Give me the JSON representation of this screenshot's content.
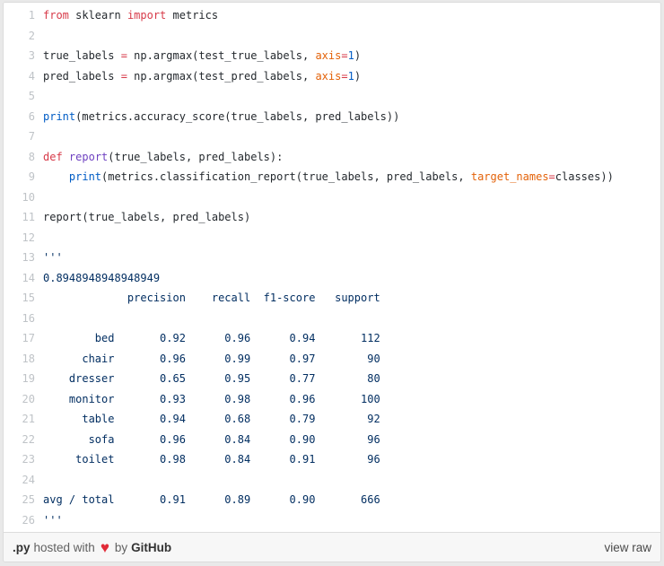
{
  "colors": {
    "keyword": "#d73a49",
    "builtin_number": "#005cc5",
    "function_name": "#6f42c1",
    "parameter": "#e36209",
    "string": "#032f62",
    "text": "#24292e",
    "line_number": "#bfc3c7",
    "border": "#dcdcdc",
    "footer_bg": "#f7f7f7",
    "footer_muted": "#616161",
    "footer_link": "#333333",
    "heart": "#e12b38"
  },
  "code": {
    "lines": [
      {
        "n": "1",
        "tokens": [
          [
            "k",
            "from"
          ],
          [
            "p",
            " sklearn "
          ],
          [
            "k",
            "import"
          ],
          [
            "p",
            " metrics"
          ]
        ]
      },
      {
        "n": "2",
        "tokens": []
      },
      {
        "n": "3",
        "tokens": [
          [
            "p",
            "true_labels "
          ],
          [
            "k",
            "="
          ],
          [
            "p",
            " np.argmax(test_true_labels, "
          ],
          [
            "o",
            "axis"
          ],
          [
            "k",
            "="
          ],
          [
            "b",
            "1"
          ],
          [
            "p",
            ")"
          ]
        ]
      },
      {
        "n": "4",
        "tokens": [
          [
            "p",
            "pred_labels "
          ],
          [
            "k",
            "="
          ],
          [
            "p",
            " np.argmax(test_pred_labels, "
          ],
          [
            "o",
            "axis"
          ],
          [
            "k",
            "="
          ],
          [
            "b",
            "1"
          ],
          [
            "p",
            ")"
          ]
        ]
      },
      {
        "n": "5",
        "tokens": []
      },
      {
        "n": "6",
        "tokens": [
          [
            "b",
            "print"
          ],
          [
            "p",
            "(metrics.accuracy_score(true_labels, pred_labels))"
          ]
        ]
      },
      {
        "n": "7",
        "tokens": []
      },
      {
        "n": "8",
        "tokens": [
          [
            "k",
            "def"
          ],
          [
            "p",
            " "
          ],
          [
            "f",
            "report"
          ],
          [
            "p",
            "(true_labels, pred_labels):"
          ]
        ]
      },
      {
        "n": "9",
        "tokens": [
          [
            "p",
            "    "
          ],
          [
            "b",
            "print"
          ],
          [
            "p",
            "(metrics.classification_report(true_labels, pred_labels, "
          ],
          [
            "o",
            "target_names"
          ],
          [
            "k",
            "="
          ],
          [
            "p",
            "classes))"
          ]
        ]
      },
      {
        "n": "10",
        "tokens": []
      },
      {
        "n": "11",
        "tokens": [
          [
            "p",
            "report(true_labels, pred_labels)"
          ]
        ]
      },
      {
        "n": "12",
        "tokens": []
      },
      {
        "n": "13",
        "tokens": [
          [
            "s",
            "'''"
          ]
        ]
      },
      {
        "n": "14",
        "tokens": [
          [
            "s",
            "0.8948948948948949"
          ]
        ]
      },
      {
        "n": "15",
        "tokens": [
          [
            "s",
            "             precision    recall  f1-score   support"
          ]
        ]
      },
      {
        "n": "16",
        "tokens": []
      },
      {
        "n": "17",
        "tokens": [
          [
            "s",
            "        bed       0.92      0.96      0.94       112"
          ]
        ]
      },
      {
        "n": "18",
        "tokens": [
          [
            "s",
            "      chair       0.96      0.99      0.97        90"
          ]
        ]
      },
      {
        "n": "19",
        "tokens": [
          [
            "s",
            "    dresser       0.65      0.95      0.77        80"
          ]
        ]
      },
      {
        "n": "20",
        "tokens": [
          [
            "s",
            "    monitor       0.93      0.98      0.96       100"
          ]
        ]
      },
      {
        "n": "21",
        "tokens": [
          [
            "s",
            "      table       0.94      0.68      0.79        92"
          ]
        ]
      },
      {
        "n": "22",
        "tokens": [
          [
            "s",
            "       sofa       0.96      0.84      0.90        96"
          ]
        ]
      },
      {
        "n": "23",
        "tokens": [
          [
            "s",
            "     toilet       0.98      0.84      0.91        96"
          ]
        ]
      },
      {
        "n": "24",
        "tokens": []
      },
      {
        "n": "25",
        "tokens": [
          [
            "s",
            "avg / total       0.91      0.89      0.90       666"
          ]
        ]
      },
      {
        "n": "26",
        "tokens": [
          [
            "s",
            "'''"
          ]
        ]
      }
    ]
  },
  "report_table": {
    "columns": [
      "precision",
      "recall",
      "f1-score",
      "support"
    ],
    "accuracy": "0.8948948948948949",
    "rows": [
      {
        "label": "bed",
        "precision": 0.92,
        "recall": 0.96,
        "f1_score": 0.94,
        "support": 112
      },
      {
        "label": "chair",
        "precision": 0.96,
        "recall": 0.99,
        "f1_score": 0.97,
        "support": 90
      },
      {
        "label": "dresser",
        "precision": 0.65,
        "recall": 0.95,
        "f1_score": 0.77,
        "support": 80
      },
      {
        "label": "monitor",
        "precision": 0.93,
        "recall": 0.98,
        "f1_score": 0.96,
        "support": 100
      },
      {
        "label": "table",
        "precision": 0.94,
        "recall": 0.68,
        "f1_score": 0.79,
        "support": 92
      },
      {
        "label": "sofa",
        "precision": 0.96,
        "recall": 0.84,
        "f1_score": 0.9,
        "support": 96
      },
      {
        "label": "toilet",
        "precision": 0.98,
        "recall": 0.84,
        "f1_score": 0.91,
        "support": 96
      },
      {
        "label": "avg / total",
        "precision": 0.91,
        "recall": 0.89,
        "f1_score": 0.9,
        "support": 666
      }
    ]
  },
  "footer": {
    "file_label": ".py",
    "hosted_with": "hosted with",
    "heart_glyph": "♥",
    "by": "by",
    "brand": "GitHub",
    "view_raw": "view raw"
  }
}
